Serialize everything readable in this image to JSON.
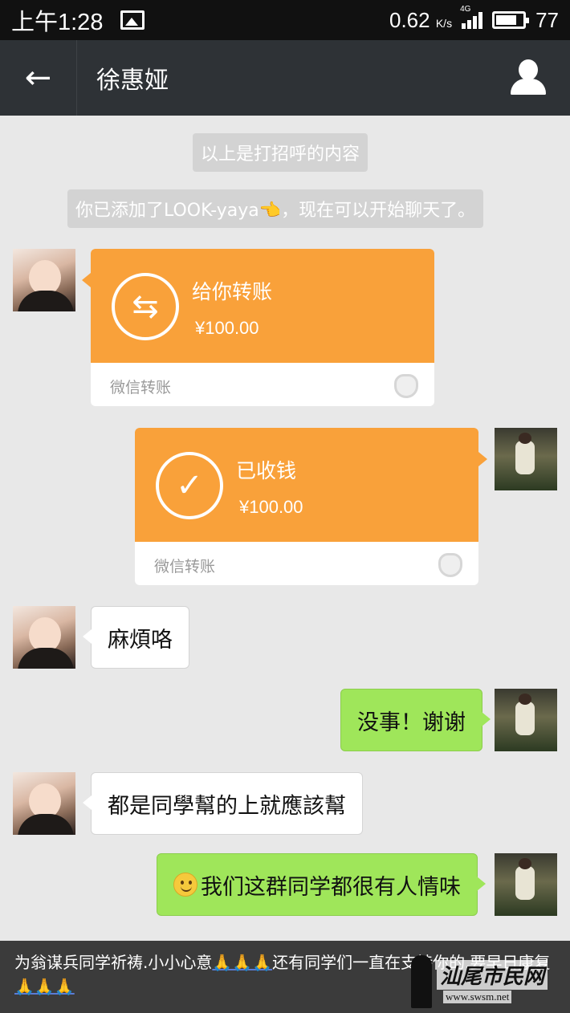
{
  "status_bar": {
    "time": "上午1:28",
    "speed": "0.62",
    "speed_unit": "K/s",
    "network": "4G",
    "battery": "77",
    "battery_level": 0.77
  },
  "nav": {
    "back_icon": "←",
    "title": "徐惠娅",
    "profile_icon": "person-icon"
  },
  "system_messages": [
    "以上是打招呼的内容",
    "你已添加了LOOK-yaya👈，现在可以开始聊天了。"
  ],
  "transfers": [
    {
      "title": "给你转账",
      "amount": "¥100.00",
      "footer": "微信转账",
      "icon": "⇆"
    },
    {
      "title": "已收钱",
      "amount": "¥100.00",
      "footer": "微信转账",
      "icon": "✓"
    }
  ],
  "messages": [
    {
      "from": "her",
      "text": "麻煩咯"
    },
    {
      "from": "me",
      "text": "没事！谢谢"
    },
    {
      "from": "her",
      "text": "都是同學幫的上就應該幫"
    },
    {
      "from": "me",
      "text": "我们这群同学都很有人情味"
    }
  ],
  "caption": {
    "text1": "为翁谋兵同学祈祷.小小心意",
    "pray1": "🙏🙏🙏",
    "text2": "还有同学们一直在支持你的.要早日康复",
    "pray2": "🙏🙏🙏"
  },
  "watermark": {
    "name": "汕尾市民网",
    "site": "www.swsm.net"
  },
  "colors": {
    "transfer_orange": "#f9a13a",
    "outgoing_green": "#9fe65a",
    "nav_bg": "#2e3236",
    "chat_bg": "#e8e8e8"
  }
}
